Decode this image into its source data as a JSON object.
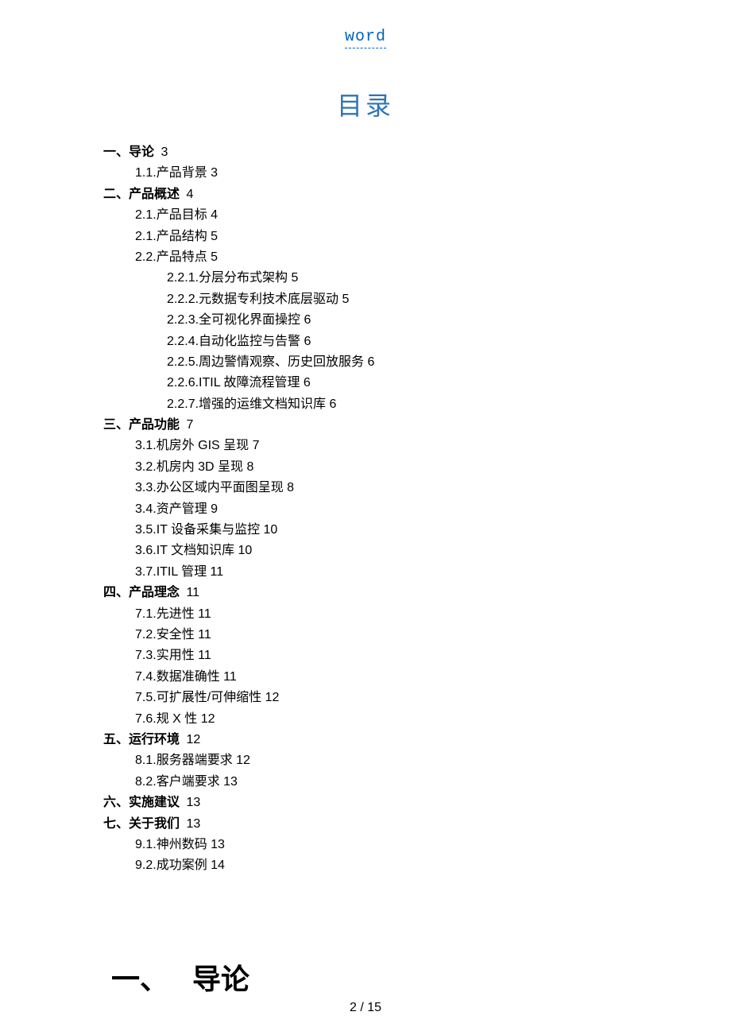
{
  "header_link": "word",
  "toc_title": "目录",
  "toc": [
    {
      "level": 1,
      "title": "一、导论",
      "page": "3"
    },
    {
      "level": 2,
      "title": "1.1.产品背景",
      "page": "3"
    },
    {
      "level": 1,
      "title": "二、产品概述",
      "page": "4"
    },
    {
      "level": 2,
      "title": "2.1.产品目标",
      "page": "4"
    },
    {
      "level": 2,
      "title": "2.1.产品结构",
      "page": "5"
    },
    {
      "level": 2,
      "title": "2.2.产品特点",
      "page": "5"
    },
    {
      "level": 3,
      "title": "2.2.1.分层分布式架构",
      "page": "5"
    },
    {
      "level": 3,
      "title": "2.2.2.元数据专利技术底层驱动",
      "page": "5"
    },
    {
      "level": 3,
      "title": "2.2.3.全可视化界面操控",
      "page": "6"
    },
    {
      "level": 3,
      "title": "2.2.4.自动化监控与告警",
      "page": "6"
    },
    {
      "level": 3,
      "title": "2.2.5.周边警情观察、历史回放服务",
      "page": "6"
    },
    {
      "level": 3,
      "title": "2.2.6.ITIL 故障流程管理",
      "page": "6"
    },
    {
      "level": 3,
      "title": "2.2.7.增强的运维文档知识库",
      "page": "6"
    },
    {
      "level": 1,
      "title": "三、产品功能",
      "page": "7"
    },
    {
      "level": 2,
      "title": "3.1.机房外 GIS 呈现",
      "page": "7"
    },
    {
      "level": 2,
      "title": "3.2.机房内 3D 呈现",
      "page": "8"
    },
    {
      "level": 2,
      "title": "3.3.办公区域内平面图呈现",
      "page": "8"
    },
    {
      "level": 2,
      "title": "3.4.资产管理",
      "page": "9"
    },
    {
      "level": 2,
      "title": "3.5.IT 设备采集与监控",
      "page": "10"
    },
    {
      "level": 2,
      "title": "3.6.IT 文档知识库",
      "page": "10"
    },
    {
      "level": 2,
      "title": "3.7.ITIL 管理",
      "page": "11"
    },
    {
      "level": 1,
      "title": "四、产品理念",
      "page": "11"
    },
    {
      "level": 2,
      "title": "7.1.先进性",
      "page": "11"
    },
    {
      "level": 2,
      "title": "7.2.安全性",
      "page": "11"
    },
    {
      "level": 2,
      "title": "7.3.实用性",
      "page": "11"
    },
    {
      "level": 2,
      "title": "7.4.数据准确性",
      "page": "11"
    },
    {
      "level": 2,
      "title": "7.5.可扩展性/可伸缩性",
      "page": "12"
    },
    {
      "level": 2,
      "title": "7.6.规 X 性",
      "page": "12"
    },
    {
      "level": 1,
      "title": "五、运行环境",
      "page": "12"
    },
    {
      "level": 2,
      "title": "8.1.服务器端要求",
      "page": "12"
    },
    {
      "level": 2,
      "title": "8.2.客户端要求",
      "page": "13"
    },
    {
      "level": 1,
      "title": "六、实施建议",
      "page": "13"
    },
    {
      "level": 1,
      "title": "七、关于我们",
      "page": "13"
    },
    {
      "level": 2,
      "title": "9.1.神州数码",
      "page": "13"
    },
    {
      "level": 2,
      "title": "9.2.成功案例",
      "page": "14"
    }
  ],
  "section_heading": {
    "num": "一、",
    "text": "导论"
  },
  "page_footer": "2 / 15"
}
